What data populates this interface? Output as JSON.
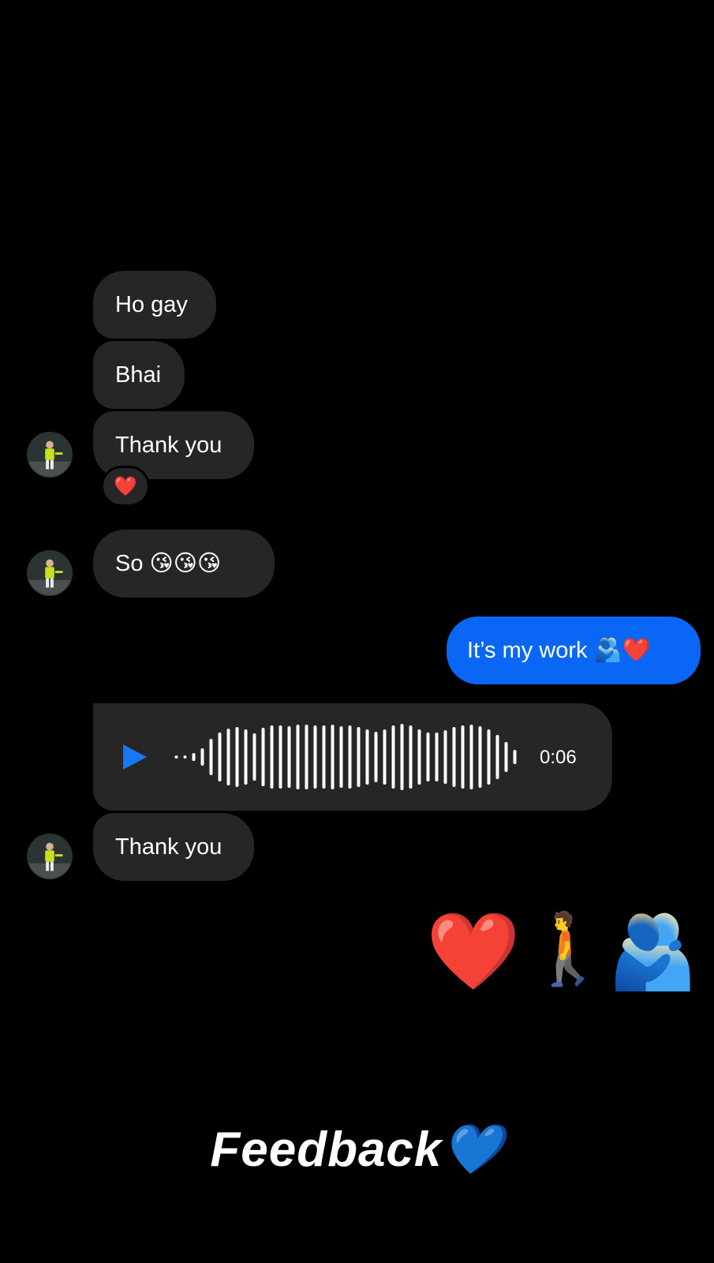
{
  "messages": [
    {
      "text": "Ho gay",
      "direction": "incoming"
    },
    {
      "text": "Bhai",
      "direction": "incoming"
    },
    {
      "text": "Thank you",
      "direction": "incoming",
      "reaction": "❤️"
    },
    {
      "text": "So 😘😘😘",
      "direction": "incoming"
    },
    {
      "text": "It’s my work 🫂❤️",
      "direction": "outgoing"
    },
    {
      "type": "voice",
      "duration": "0:06",
      "direction": "incoming"
    },
    {
      "text": "Thank you",
      "direction": "incoming"
    }
  ],
  "reaction_emoji": "❤️",
  "voice_message": {
    "duration": "0:06",
    "play_icon": "play-icon"
  },
  "big_emojis": [
    "❤️",
    "🚶",
    "🫂"
  ],
  "caption": "Feedback💙",
  "colors": {
    "background": "#000000",
    "incoming_bubble": "#262626",
    "outgoing_bubble": "#0a67f5",
    "play_icon": "#1877f2"
  }
}
